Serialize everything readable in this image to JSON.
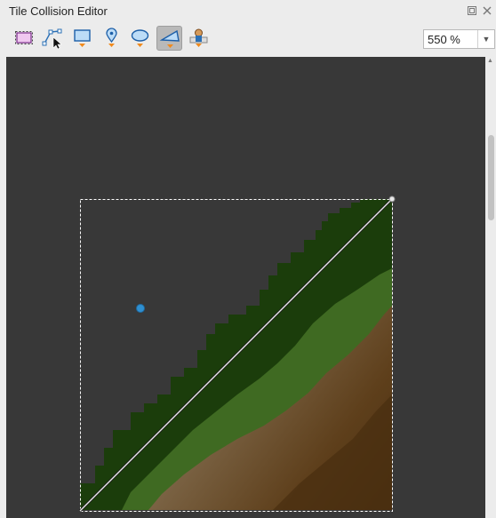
{
  "window": {
    "title": "Tile Collision Editor",
    "float_icon": "float-icon",
    "close_icon": "close-icon"
  },
  "toolbar": {
    "tools": [
      {
        "name": "select-objects-icon",
        "active": false
      },
      {
        "name": "edit-polygons-icon",
        "active": false
      },
      {
        "name": "insert-rectangle-icon",
        "active": false
      },
      {
        "name": "insert-point-icon",
        "active": false
      },
      {
        "name": "insert-ellipse-icon",
        "active": false
      },
      {
        "name": "insert-polygon-icon",
        "active": true
      },
      {
        "name": "insert-template-icon",
        "active": false
      }
    ],
    "zoom": {
      "value": "550 %"
    }
  },
  "colors": {
    "canvas": "#383838",
    "grass_dark": "#1b3d0b",
    "grass_mid": "#3f6a22",
    "dirt_light": "#7a6243",
    "dirt_dark": "#4a2f10",
    "handle": "#2f8fd0"
  }
}
